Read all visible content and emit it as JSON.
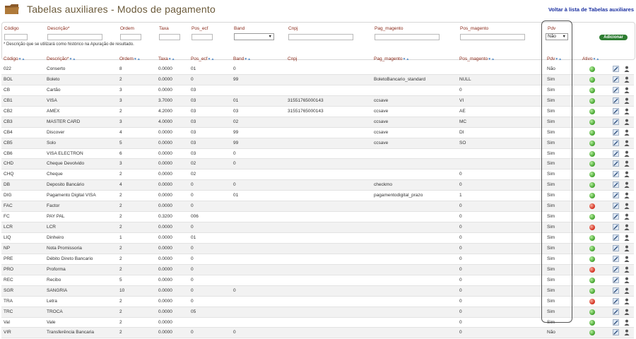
{
  "header": {
    "title": "Tabelas auxiliares - Modos de pagamento",
    "back_link": "Voltar à lista de Tabelas auxiliares"
  },
  "form": {
    "labels": {
      "codigo": "Código",
      "descricao": "Descrição*",
      "ordem": "Ordem",
      "taxa": "Taxa",
      "pos_ecf": "Pos_ecf",
      "band": "Band",
      "cnpj": "Cnpj",
      "pag_magento": "Pag_magento",
      "pos_magento": "Pos_magento",
      "pdv": "Pdv"
    },
    "band_select_value": "",
    "pdv_select_value": "Não",
    "add_button": "Adicionar",
    "note": "* Descrição que se utilizará como histórico na Apuração de resultado."
  },
  "columns": {
    "codigo": "Código",
    "descricao": "Descrição*",
    "ordem": "Ordem",
    "taxa": "Taxa",
    "pos_ecf": "Pos_ecf",
    "band": "Band",
    "cnpj": "Cnpj",
    "pag_magento": "Pag_magento",
    "pos_magento": "Pos_magento",
    "pdv": "Pdv",
    "ativo": "Ativo",
    "sort_glyph": "▼▲"
  },
  "rows": [
    {
      "codigo": "022",
      "descricao": "Conserto",
      "ordem": "8",
      "taxa": "0.0000",
      "pos_ecf": "01",
      "band": "0",
      "cnpj": "",
      "pag_magento": "",
      "pos_magento": "",
      "pdv": "Não",
      "ativo": true
    },
    {
      "codigo": "BOL",
      "descricao": "Boleto",
      "ordem": "2",
      "taxa": "0.0000",
      "pos_ecf": "0",
      "band": "99",
      "cnpj": "",
      "pag_magento": "BoletoBancario_standard",
      "pos_magento": "NULL",
      "pdv": "Sim",
      "ativo": true
    },
    {
      "codigo": "CB",
      "descricao": "Cartão",
      "ordem": "3",
      "taxa": "0.0000",
      "pos_ecf": "03",
      "band": "",
      "cnpj": "",
      "pag_magento": "",
      "pos_magento": "0",
      "pdv": "Sim",
      "ativo": true
    },
    {
      "codigo": "CB1",
      "descricao": "VISA",
      "ordem": "3",
      "taxa": "3.7000",
      "pos_ecf": "03",
      "band": "01",
      "cnpj": "31551765000143",
      "pag_magento": "ccsave",
      "pos_magento": "VI",
      "pdv": "Sim",
      "ativo": true
    },
    {
      "codigo": "CB2",
      "descricao": "AMEX",
      "ordem": "2",
      "taxa": "4.2000",
      "pos_ecf": "03",
      "band": "03",
      "cnpj": "31551765000143",
      "pag_magento": "ccsave",
      "pos_magento": "AE",
      "pdv": "Sim",
      "ativo": true
    },
    {
      "codigo": "CB3",
      "descricao": "MASTER CARD",
      "ordem": "3",
      "taxa": "4.0000",
      "pos_ecf": "03",
      "band": "02",
      "cnpj": "",
      "pag_magento": "ccsave",
      "pos_magento": "MC",
      "pdv": "Sim",
      "ativo": true
    },
    {
      "codigo": "CB4",
      "descricao": "Discover",
      "ordem": "4",
      "taxa": "0.0000",
      "pos_ecf": "03",
      "band": "99",
      "cnpj": "",
      "pag_magento": "ccsave",
      "pos_magento": "DI",
      "pdv": "Sim",
      "ativo": true
    },
    {
      "codigo": "CB5",
      "descricao": "Solo",
      "ordem": "5",
      "taxa": "0.0000",
      "pos_ecf": "03",
      "band": "99",
      "cnpj": "",
      "pag_magento": "ccsave",
      "pos_magento": "SO",
      "pdv": "Sim",
      "ativo": true
    },
    {
      "codigo": "CB6",
      "descricao": "VISA ELECTRON",
      "ordem": "6",
      "taxa": "0.0000",
      "pos_ecf": "03",
      "band": "0",
      "cnpj": "",
      "pag_magento": "",
      "pos_magento": "",
      "pdv": "Sim",
      "ativo": true
    },
    {
      "codigo": "CHD",
      "descricao": "Cheque Devolvido",
      "ordem": "3",
      "taxa": "0.0000",
      "pos_ecf": "02",
      "band": "0",
      "cnpj": "",
      "pag_magento": "",
      "pos_magento": "",
      "pdv": "Sim",
      "ativo": true
    },
    {
      "codigo": "CHQ",
      "descricao": "Cheque",
      "ordem": "2",
      "taxa": "0.0000",
      "pos_ecf": "02",
      "band": "",
      "cnpj": "",
      "pag_magento": "",
      "pos_magento": "0",
      "pdv": "Sim",
      "ativo": true
    },
    {
      "codigo": "DB",
      "descricao": "Deposito Bancário",
      "ordem": "4",
      "taxa": "0.0000",
      "pos_ecf": "0",
      "band": "0",
      "cnpj": "",
      "pag_magento": "checkmo",
      "pos_magento": "0",
      "pdv": "Sim",
      "ativo": true
    },
    {
      "codigo": "DIG",
      "descricao": "Pagamento Digital VISA",
      "ordem": "2",
      "taxa": "0.0000",
      "pos_ecf": "0",
      "band": "01",
      "cnpj": "",
      "pag_magento": "pagamentodigital_prazo",
      "pos_magento": "1",
      "pdv": "Sim",
      "ativo": true
    },
    {
      "codigo": "FAC",
      "descricao": "Factor",
      "ordem": "2",
      "taxa": "0.0000",
      "pos_ecf": "0",
      "band": "",
      "cnpj": "",
      "pag_magento": "",
      "pos_magento": "0",
      "pdv": "Sim",
      "ativo": false
    },
    {
      "codigo": "FC",
      "descricao": "PAY PAL",
      "ordem": "2",
      "taxa": "0.3200",
      "pos_ecf": "006",
      "band": "",
      "cnpj": "",
      "pag_magento": "",
      "pos_magento": "0",
      "pdv": "Sim",
      "ativo": true
    },
    {
      "codigo": "LCR",
      "descricao": "LCR",
      "ordem": "2",
      "taxa": "0.0000",
      "pos_ecf": "0",
      "band": "",
      "cnpj": "",
      "pag_magento": "",
      "pos_magento": "0",
      "pdv": "Sim",
      "ativo": false
    },
    {
      "codigo": "LIQ",
      "descricao": "Dinheiro",
      "ordem": "1",
      "taxa": "0.0000",
      "pos_ecf": "01",
      "band": "",
      "cnpj": "",
      "pag_magento": "",
      "pos_magento": "0",
      "pdv": "Sim",
      "ativo": true
    },
    {
      "codigo": "NP",
      "descricao": "Nota Promissoria",
      "ordem": "2",
      "taxa": "0.0000",
      "pos_ecf": "0",
      "band": "",
      "cnpj": "",
      "pag_magento": "",
      "pos_magento": "0",
      "pdv": "Sim",
      "ativo": true
    },
    {
      "codigo": "PRE",
      "descricao": "Débito Direto Bancario",
      "ordem": "2",
      "taxa": "0.0000",
      "pos_ecf": "0",
      "band": "",
      "cnpj": "",
      "pag_magento": "",
      "pos_magento": "0",
      "pdv": "Sim",
      "ativo": true
    },
    {
      "codigo": "PRO",
      "descricao": "Proforma",
      "ordem": "2",
      "taxa": "0.0000",
      "pos_ecf": "0",
      "band": "",
      "cnpj": "",
      "pag_magento": "",
      "pos_magento": "0",
      "pdv": "Sim",
      "ativo": false
    },
    {
      "codigo": "REC",
      "descricao": "Recibo",
      "ordem": "5",
      "taxa": "0.0000",
      "pos_ecf": "0",
      "band": "",
      "cnpj": "",
      "pag_magento": "",
      "pos_magento": "0",
      "pdv": "Sim",
      "ativo": true
    },
    {
      "codigo": "SGR",
      "descricao": "SANGRIA",
      "ordem": "10",
      "taxa": "0.0000",
      "pos_ecf": "0",
      "band": "0",
      "cnpj": "",
      "pag_magento": "",
      "pos_magento": "0",
      "pdv": "Sim",
      "ativo": true
    },
    {
      "codigo": "TRA",
      "descricao": "Letra",
      "ordem": "2",
      "taxa": "0.0000",
      "pos_ecf": "0",
      "band": "",
      "cnpj": "",
      "pag_magento": "",
      "pos_magento": "0",
      "pdv": "Sim",
      "ativo": false
    },
    {
      "codigo": "TRC",
      "descricao": "TROCA",
      "ordem": "2",
      "taxa": "0.0000",
      "pos_ecf": "05",
      "band": "",
      "cnpj": "",
      "pag_magento": "",
      "pos_magento": "0",
      "pdv": "Sim",
      "ativo": true
    },
    {
      "codigo": "Val",
      "descricao": "Vale",
      "ordem": "2",
      "taxa": "0.0000",
      "pos_ecf": "",
      "band": "",
      "cnpj": "",
      "pag_magento": "",
      "pos_magento": "0",
      "pdv": "Sim",
      "ativo": true
    },
    {
      "codigo": "VIR",
      "descricao": "Transferência Bancaria",
      "ordem": "2",
      "taxa": "0.0000",
      "pos_ecf": "0",
      "band": "0",
      "cnpj": "",
      "pag_magento": "",
      "pos_magento": "0",
      "pdv": "Não",
      "ativo": true
    }
  ],
  "colors": {
    "title": "#6b5a3a",
    "link": "#1a2fa0",
    "header_text": "#8a2a1a",
    "add_button": "#2e7d32",
    "active_on": "#3fa02a",
    "active_off": "#d22a1a"
  },
  "icons": {
    "page": "folder-icon",
    "edit": "edit-icon",
    "user": "user-icon",
    "status": "status-dot-icon"
  }
}
